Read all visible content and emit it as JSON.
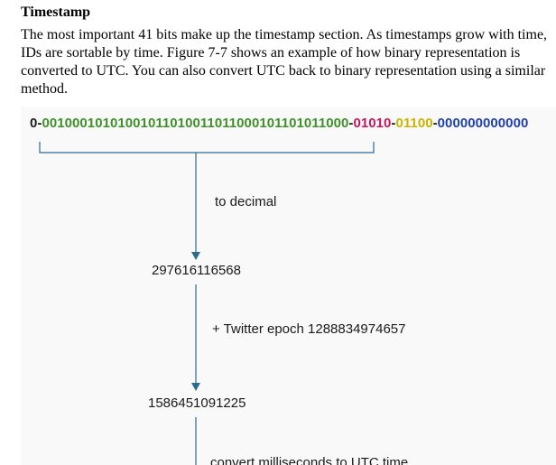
{
  "section": {
    "title": "Timestamp",
    "lines": [
      "The most important 41 bits make up the timestamp section. As timestamps grow with time,",
      "IDs are sortable by time. Figure 7-7 shows an example of how binary representation is",
      "converted to UTC. You can also convert UTC back to binary representation using a similar",
      "method."
    ]
  },
  "diagram": {
    "bits": {
      "sign": "0",
      "timestamp": "00100010101001011010011011000101101011000",
      "datacenter": "01010",
      "machine": "01100",
      "sequence": "000000000000",
      "separator": "-"
    },
    "colors": {
      "sign": "#1a1a1a",
      "timestamp": "#3f8f2a",
      "datacenter": "#c2185b",
      "machine": "#c9b400",
      "sequence": "#1f3fb0",
      "arrow": "#2e6a8f",
      "bracket": "#2e6a8f"
    },
    "steps": [
      {
        "label": "to decimal"
      },
      {
        "value": "297616116568"
      },
      {
        "label": "+ Twitter epoch 1288834974657"
      },
      {
        "value": "1586451091225"
      },
      {
        "label": "convert milliseconds to UTC time"
      }
    ]
  }
}
